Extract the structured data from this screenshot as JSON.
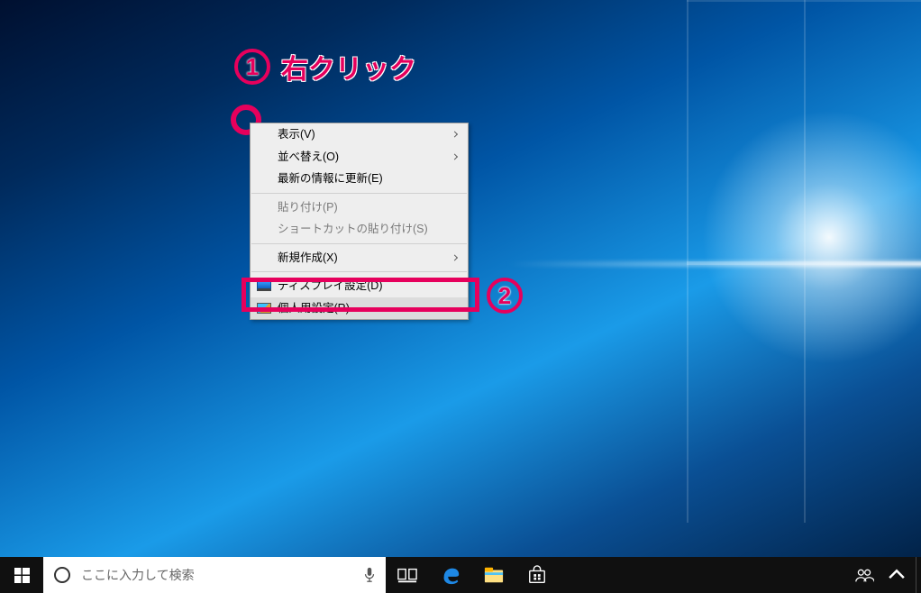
{
  "annotations": {
    "step1_number": "1",
    "step1_label": "右クリック",
    "step2_number": "2"
  },
  "context_menu": {
    "view": "表示(V)",
    "sort": "並べ替え(O)",
    "refresh": "最新の情報に更新(E)",
    "paste": "貼り付け(P)",
    "paste_shortcut": "ショートカットの貼り付け(S)",
    "new": "新規作成(X)",
    "display": "ディスプレイ設定(D)",
    "personalize": "個人用設定(R)"
  },
  "taskbar": {
    "search_placeholder": "ここに入力して検索"
  },
  "colors": {
    "accent": "#e6005c"
  }
}
